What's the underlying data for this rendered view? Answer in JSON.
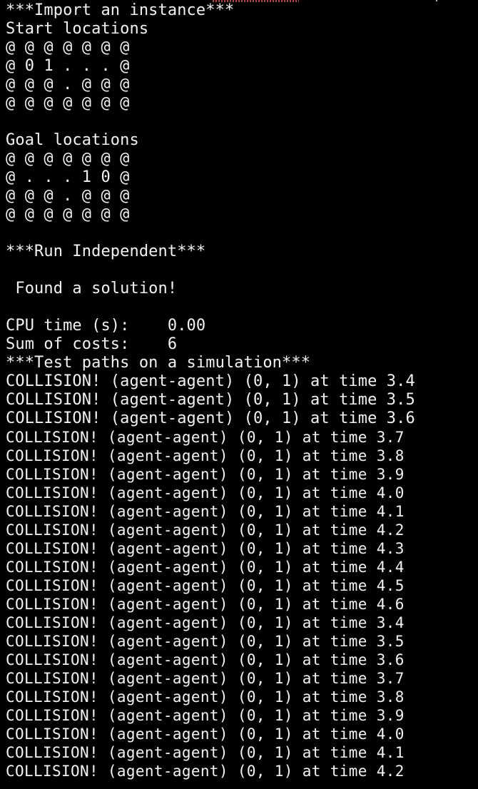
{
  "terminal": {
    "lines": [
      "***Import an instance***",
      "Start locations",
      "@ @ @ @ @ @ @",
      "@ 0 1 . . . @",
      "@ @ @ . @ @ @",
      "@ @ @ @ @ @ @",
      "",
      "Goal locations",
      "@ @ @ @ @ @ @",
      "@ . . . 1 0 @",
      "@ @ @ . @ @ @",
      "@ @ @ @ @ @ @",
      "",
      "***Run Independent***",
      "",
      " Found a solution!",
      "",
      "CPU time (s):    0.00",
      "Sum of costs:    6",
      "***Test paths on a simulation***",
      "COLLISION! (agent-agent) (0, 1) at time 3.4",
      "COLLISION! (agent-agent) (0, 1) at time 3.5",
      "COLLISION! (agent-agent) (0, 1) at time 3.6",
      "COLLISION! (agent-agent) (0, 1) at time 3.7",
      "COLLISION! (agent-agent) (0, 1) at time 3.8",
      "COLLISION! (agent-agent) (0, 1) at time 3.9",
      "COLLISION! (agent-agent) (0, 1) at time 4.0",
      "COLLISION! (agent-agent) (0, 1) at time 4.1",
      "COLLISION! (agent-agent) (0, 1) at time 4.2",
      "COLLISION! (agent-agent) (0, 1) at time 4.3",
      "COLLISION! (agent-agent) (0, 1) at time 4.4",
      "COLLISION! (agent-agent) (0, 1) at time 4.5",
      "COLLISION! (agent-agent) (0, 1) at time 4.6",
      "COLLISION! (agent-agent) (0, 1) at time 3.4",
      "COLLISION! (agent-agent) (0, 1) at time 3.5",
      "COLLISION! (agent-agent) (0, 1) at time 3.6",
      "COLLISION! (agent-agent) (0, 1) at time 3.7",
      "COLLISION! (agent-agent) (0, 1) at time 3.8",
      "COLLISION! (agent-agent) (0, 1) at time 3.9",
      "COLLISION! (agent-agent) (0, 1) at time 4.0",
      "COLLISION! (agent-agent) (0, 1) at time 4.1",
      "COLLISION! (agent-agent) (0, 1) at time 4.2"
    ]
  },
  "colors": {
    "background": "#000000",
    "text": "#f2f2f2",
    "squiggle": "#d14b4b"
  }
}
